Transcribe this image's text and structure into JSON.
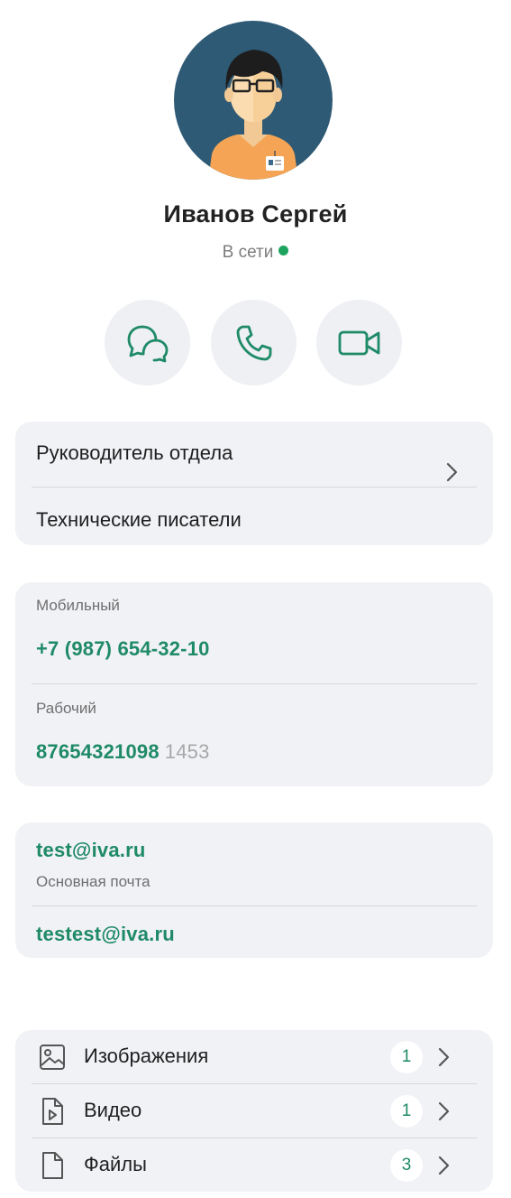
{
  "profile": {
    "name": "Иванов Сергей",
    "status": "В сети",
    "status_color": "#1fa45f"
  },
  "actions": {
    "icons": [
      "chat-icon",
      "phone-icon",
      "video-camera-icon"
    ]
  },
  "org": {
    "position": "Руководитель отдела",
    "department": "Технические писатели"
  },
  "phones": {
    "mobile_label": "Мобильный",
    "mobile_value": "+7 (987) 654-32-10",
    "work_label": "Рабочий",
    "work_value": "87654321098",
    "work_ext": "1453"
  },
  "emails": {
    "primary_value": "test@iva.ru",
    "primary_label": "Основная почта",
    "secondary_value": "testest@iva.ru"
  },
  "media": {
    "items": [
      {
        "label": "Изображения",
        "count": "1",
        "icon": "image-icon"
      },
      {
        "label": "Видео",
        "count": "1",
        "icon": "video-file-icon"
      },
      {
        "label": "Файлы",
        "count": "3",
        "icon": "file-icon"
      }
    ]
  },
  "colors": {
    "accent": "#1f8a66",
    "card_bg": "#f1f2f6"
  }
}
